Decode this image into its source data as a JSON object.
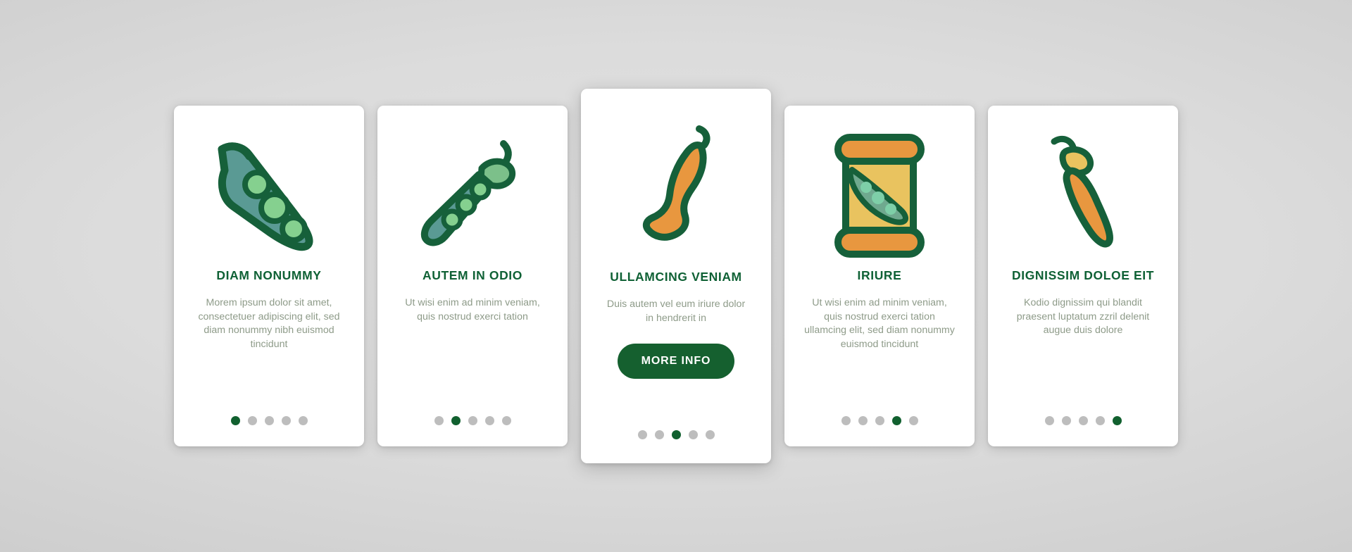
{
  "palette": {
    "background_outer": "#c9c9c9",
    "background_inner": "#e2e2e2",
    "card_background": "#ffffff",
    "title_green": "#0f6135",
    "body_text": "#8e9b89",
    "button_green": "#15602f",
    "dot_active": "#11602f",
    "dot_inactive": "#bdbdbd",
    "outline_dark_green": "#16603a",
    "pod_fill_teal": "#5a9a94",
    "pea_light_green": "#85d08f",
    "pod_fill_green": "#7cc08a",
    "orange": "#e8973f",
    "orange_light": "#e79a45",
    "yellow": "#e9c35f",
    "pea_mint": "#7ecfa8"
  },
  "cards": [
    {
      "id": "card-diam-nonummy",
      "icon": "pea-pod-open-icon",
      "title": "DIAM NONUMMY",
      "body": "Morem ipsum dolor sit amet, consectetuer adipiscing elit, sed diam nonummy nibh euismod tincidunt",
      "featured": false,
      "dots": {
        "count": 5,
        "active_index": 0
      }
    },
    {
      "id": "card-autem-in-odio",
      "icon": "pea-pod-diagonal-icon",
      "title": "AUTEM IN ODIO",
      "body": "Ut wisi enim ad minim veniam, quis nostrud exerci tation",
      "featured": false,
      "dots": {
        "count": 5,
        "active_index": 1
      }
    },
    {
      "id": "card-ullamcing-veniam",
      "icon": "chili-pepper-orange-icon",
      "title": "ULLAMCING VENIAM",
      "body": "Duis autem vel eum iriure dolor in hendrerit in",
      "featured": true,
      "button_label": "MORE INFO",
      "dots": {
        "count": 5,
        "active_index": 2
      }
    },
    {
      "id": "card-iriure",
      "icon": "pea-jar-icon",
      "title": "IRIURE",
      "body": "Ut wisi enim ad minim veniam, quis nostrud exerci tation ullamcing elit, sed diam nonummy euismod tincidunt",
      "featured": false,
      "dots": {
        "count": 5,
        "active_index": 3
      }
    },
    {
      "id": "card-dignissim-doloe-eit",
      "icon": "chili-pepper-stem-icon",
      "title": "DIGNISSIM DOLOE EIT",
      "body": "Kodio dignissim qui blandit praesent luptatum zzril delenit augue duis dolore",
      "featured": false,
      "dots": {
        "count": 5,
        "active_index": 4
      }
    }
  ]
}
